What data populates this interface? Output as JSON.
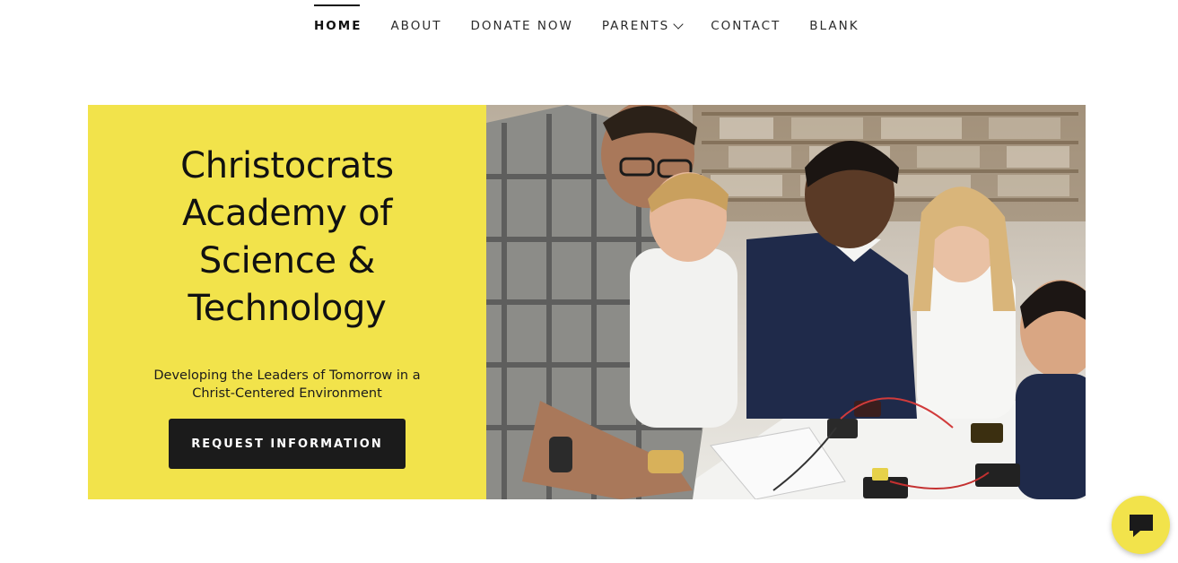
{
  "nav": {
    "items": [
      {
        "label": "HOME",
        "active": true
      },
      {
        "label": "ABOUT",
        "active": false
      },
      {
        "label": "DONATE NOW",
        "active": false
      },
      {
        "label": "PARENTS",
        "active": false,
        "has_dropdown": true
      },
      {
        "label": "CONTACT",
        "active": false
      },
      {
        "label": "BLANK",
        "active": false
      }
    ]
  },
  "hero": {
    "title": "Christocrats Academy of Science & Technology",
    "subtitle": "Developing the Leaders of Tomorrow in a Christ-Centered Environment",
    "cta_label": "REQUEST INFORMATION",
    "photo_icon": "classroom-photo"
  },
  "chat": {
    "icon": "chat-bubble-icon"
  },
  "colors": {
    "accent": "#f2e34b",
    "dark": "#1b1b1b",
    "background": "#ffffff"
  }
}
